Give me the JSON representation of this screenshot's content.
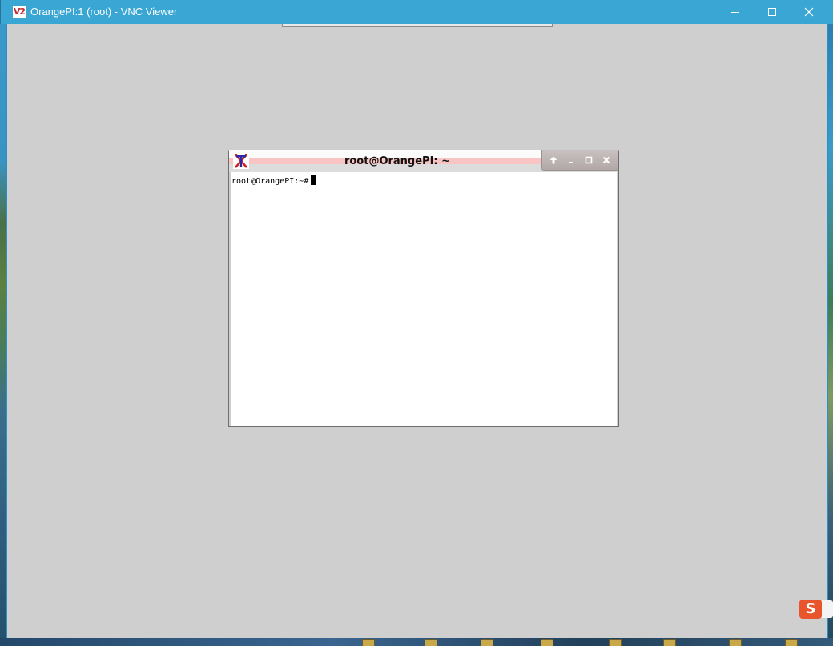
{
  "window": {
    "app_icon_text": "V2",
    "title": "OrangePI:1 (root) - VNC Viewer"
  },
  "xterm": {
    "title": "root@OrangePI: ~",
    "prompt": "root@OrangePI:~#"
  },
  "ime": {
    "label": "S"
  },
  "colors": {
    "titlebar": "#39a6d4",
    "viewport_bg": "#cfcfcf",
    "xterm_title_stripe": "#f8c4c4"
  },
  "icons": [
    "app-icon",
    "minimize-icon",
    "maximize-icon",
    "close-icon",
    "xterm-icon",
    "shade-icon",
    "iconify-icon",
    "zoom-icon",
    "xterm-close-icon",
    "sogou-ime-icon"
  ]
}
